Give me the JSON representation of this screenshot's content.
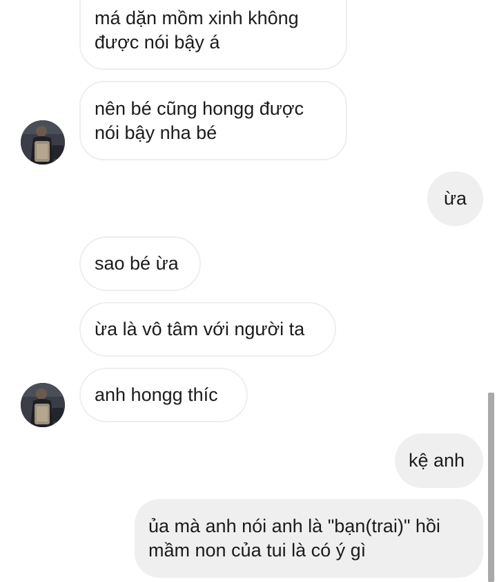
{
  "conversation": {
    "messages": [
      {
        "side": "incoming",
        "text": "má dặn mồm xinh không được nói bậy á"
      },
      {
        "side": "incoming",
        "text": "nên bé cũng hongg được nói bậy nha bé"
      },
      {
        "side": "outgoing",
        "text": "ừa"
      },
      {
        "side": "incoming",
        "text": "sao bé ừa"
      },
      {
        "side": "incoming",
        "text": "ừa là vô tâm với người ta"
      },
      {
        "side": "incoming",
        "text": "anh hongg thíc"
      },
      {
        "side": "outgoing",
        "text": "kệ anh"
      },
      {
        "side": "outgoing",
        "text": "ủa mà anh nói anh là \"bạn(trai)\" hồi mầm non của tui là có ý gì"
      }
    ],
    "avatar_icon": "contact-avatar-icon"
  },
  "colors": {
    "incoming_bubble_bg": "#ffffff",
    "incoming_bubble_border": "#eeeeee",
    "outgoing_bubble_bg": "#efefef",
    "text": "#1b1b1b",
    "scrollbar": "#a9a9a9"
  }
}
